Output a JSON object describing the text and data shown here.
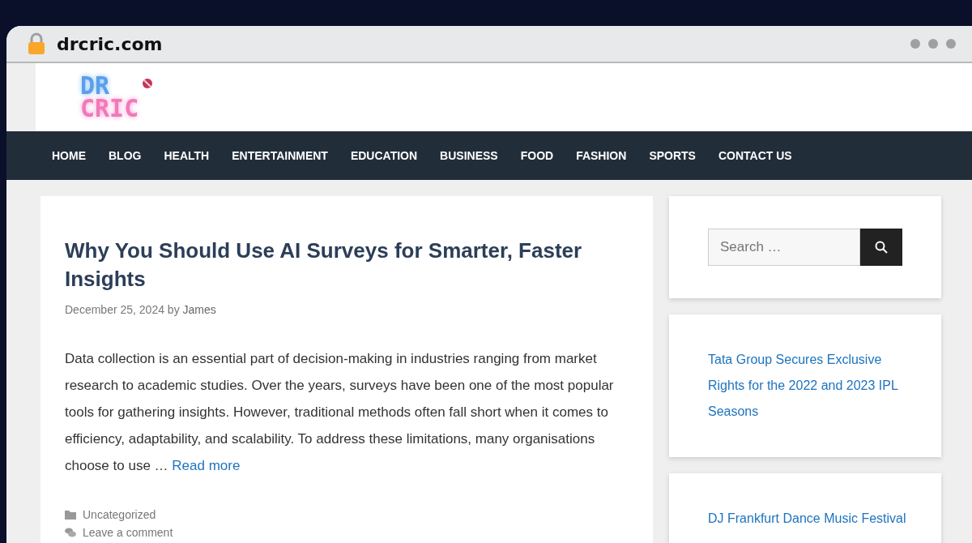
{
  "browser": {
    "url": "drcric.com"
  },
  "logo": {
    "line1": "DR",
    "line2": "CRIC"
  },
  "nav": [
    {
      "label": "HOME"
    },
    {
      "label": "BLOG"
    },
    {
      "label": "HEALTH"
    },
    {
      "label": "ENTERTAINMENT"
    },
    {
      "label": "EDUCATION"
    },
    {
      "label": "BUSINESS"
    },
    {
      "label": "FOOD"
    },
    {
      "label": "FASHION"
    },
    {
      "label": "SPORTS"
    },
    {
      "label": "CONTACT US"
    }
  ],
  "article": {
    "title": "Why You Should Use AI Surveys for Smarter, Faster Insights",
    "date": "December 25, 2024",
    "by": "by",
    "author": "James",
    "excerpt": "Data collection is an essential part of decision-making in industries ranging from market research to academic studies. Over the years, surveys have been one of the most popular tools for gathering insights. However, traditional methods often fall short when it comes to efficiency, adaptability, and scalability. To address these limitations, many organisations choose to use …",
    "read_more": "Read more",
    "category": "Uncategorized",
    "comment": "Leave a comment"
  },
  "search": {
    "placeholder": "Search …"
  },
  "sidebar_links": [
    {
      "text": "Tata Group Secures Exclusive Rights for the 2022 and 2023 IPL Seasons"
    },
    {
      "text": "DJ Frankfurt Dance Music Festival"
    }
  ]
}
